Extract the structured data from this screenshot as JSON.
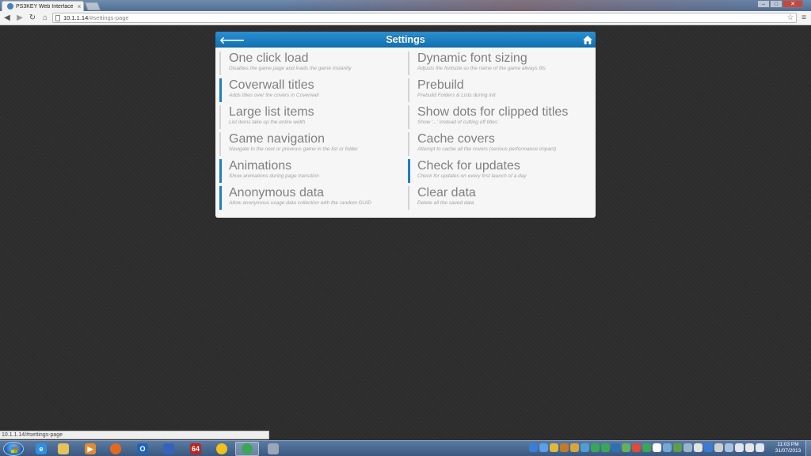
{
  "browser": {
    "tab_title": "PS3KEY Web Interface",
    "tab_close": "×",
    "url_host": "10.1.1.14",
    "url_path": "/#settings-page",
    "status_url": "10.1.1.14/#settings-page"
  },
  "page": {
    "title": "Settings",
    "settings": [
      {
        "title": "One click load",
        "desc": "Disables the game page and loads the game instantly",
        "enabled": false
      },
      {
        "title": "Dynamic font sizing",
        "desc": "Adjusts the fontsize so the name of the game always fits",
        "enabled": false
      },
      {
        "title": "Coverwall titles",
        "desc": "Adds titles over the covers in Coverwall",
        "enabled": true
      },
      {
        "title": "Prebuild",
        "desc": "Prebuild Folders & Lists during init",
        "enabled": false
      },
      {
        "title": "Large list items",
        "desc": "List items take up the entire width",
        "enabled": false
      },
      {
        "title": "Show dots for clipped titles",
        "desc": "Show '...' instead of cutting off titles",
        "enabled": false
      },
      {
        "title": "Game navigation",
        "desc": "Navigate to the next or previous game in the list or folder",
        "enabled": false
      },
      {
        "title": "Cache covers",
        "desc": "Attempt to cache all the covers (serious performance impact)",
        "enabled": false
      },
      {
        "title": "Animations",
        "desc": "Show animations during page transition",
        "enabled": true
      },
      {
        "title": "Check for updates",
        "desc": "Check for updates on every first launch of a day",
        "enabled": true
      },
      {
        "title": "Anonymous data",
        "desc": "Allow anonymous usage data collection with the random GUID",
        "enabled": true
      },
      {
        "title": "Clear data",
        "desc": "Delete all the saved data",
        "enabled": false
      }
    ]
  },
  "taskbar": {
    "pinned": [
      {
        "name": "internet-explorer",
        "glyph": "e",
        "color": "#2f8fe0"
      },
      {
        "name": "file-explorer",
        "glyph": "",
        "color": "#e7c15a"
      },
      {
        "name": "media-player",
        "glyph": "▶",
        "color": "#e58b2d"
      },
      {
        "name": "firefox",
        "glyph": "",
        "color": "#e36a1d"
      },
      {
        "name": "outlook",
        "glyph": "O",
        "color": "#1f64b5"
      },
      {
        "name": "app-blue",
        "glyph": "",
        "color": "#3563b9"
      },
      {
        "name": "app-64",
        "glyph": "64",
        "color": "#b8261f"
      },
      {
        "name": "app-yellow",
        "glyph": "",
        "color": "#f0c21a"
      },
      {
        "name": "chrome",
        "glyph": "",
        "color": "#3aa757"
      },
      {
        "name": "app-gear",
        "glyph": "",
        "color": "#9aa7b8"
      }
    ],
    "clock_time": "11:03 PM",
    "clock_date": "31/07/2013"
  },
  "colors": {
    "accent": "#1e7fc2",
    "header": "#1a7cc0"
  }
}
